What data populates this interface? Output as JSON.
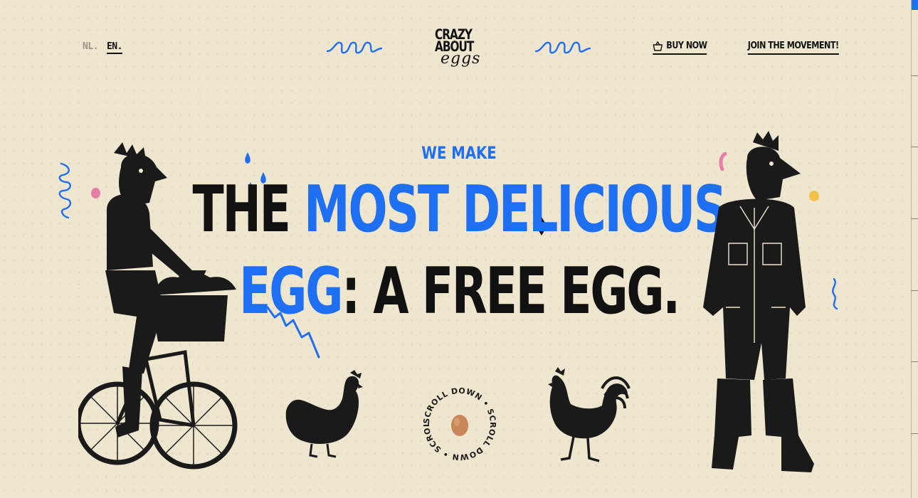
{
  "header": {
    "languages": [
      {
        "code": "NL.",
        "active": false
      },
      {
        "code": "EN.",
        "active": true
      }
    ],
    "logo": {
      "line1": "CRAZY",
      "line2": "ABOUT",
      "line3": "eggs"
    },
    "nav": {
      "buy_now": "BUY NOW",
      "join": "JOIN THE MOVEMENT!"
    }
  },
  "hero": {
    "eyebrow": "WE MAKE",
    "line1_black": "THE ",
    "line1_blue": "MOST DELICIOUS",
    "line2_blue": "EGG",
    "line2_black": ": A FREE EGG."
  },
  "scroll_badge": {
    "text": "SCROLL DOWN • SCROLL DOWN • SCROLL DOWN • "
  },
  "colors": {
    "background": "#efe6cf",
    "accent": "#1f6ff2",
    "ink": "#111111",
    "pink": "#e67ea6",
    "yellow": "#f0c24a"
  },
  "icons": {
    "basket": "basket-icon",
    "egg": "egg-icon"
  }
}
